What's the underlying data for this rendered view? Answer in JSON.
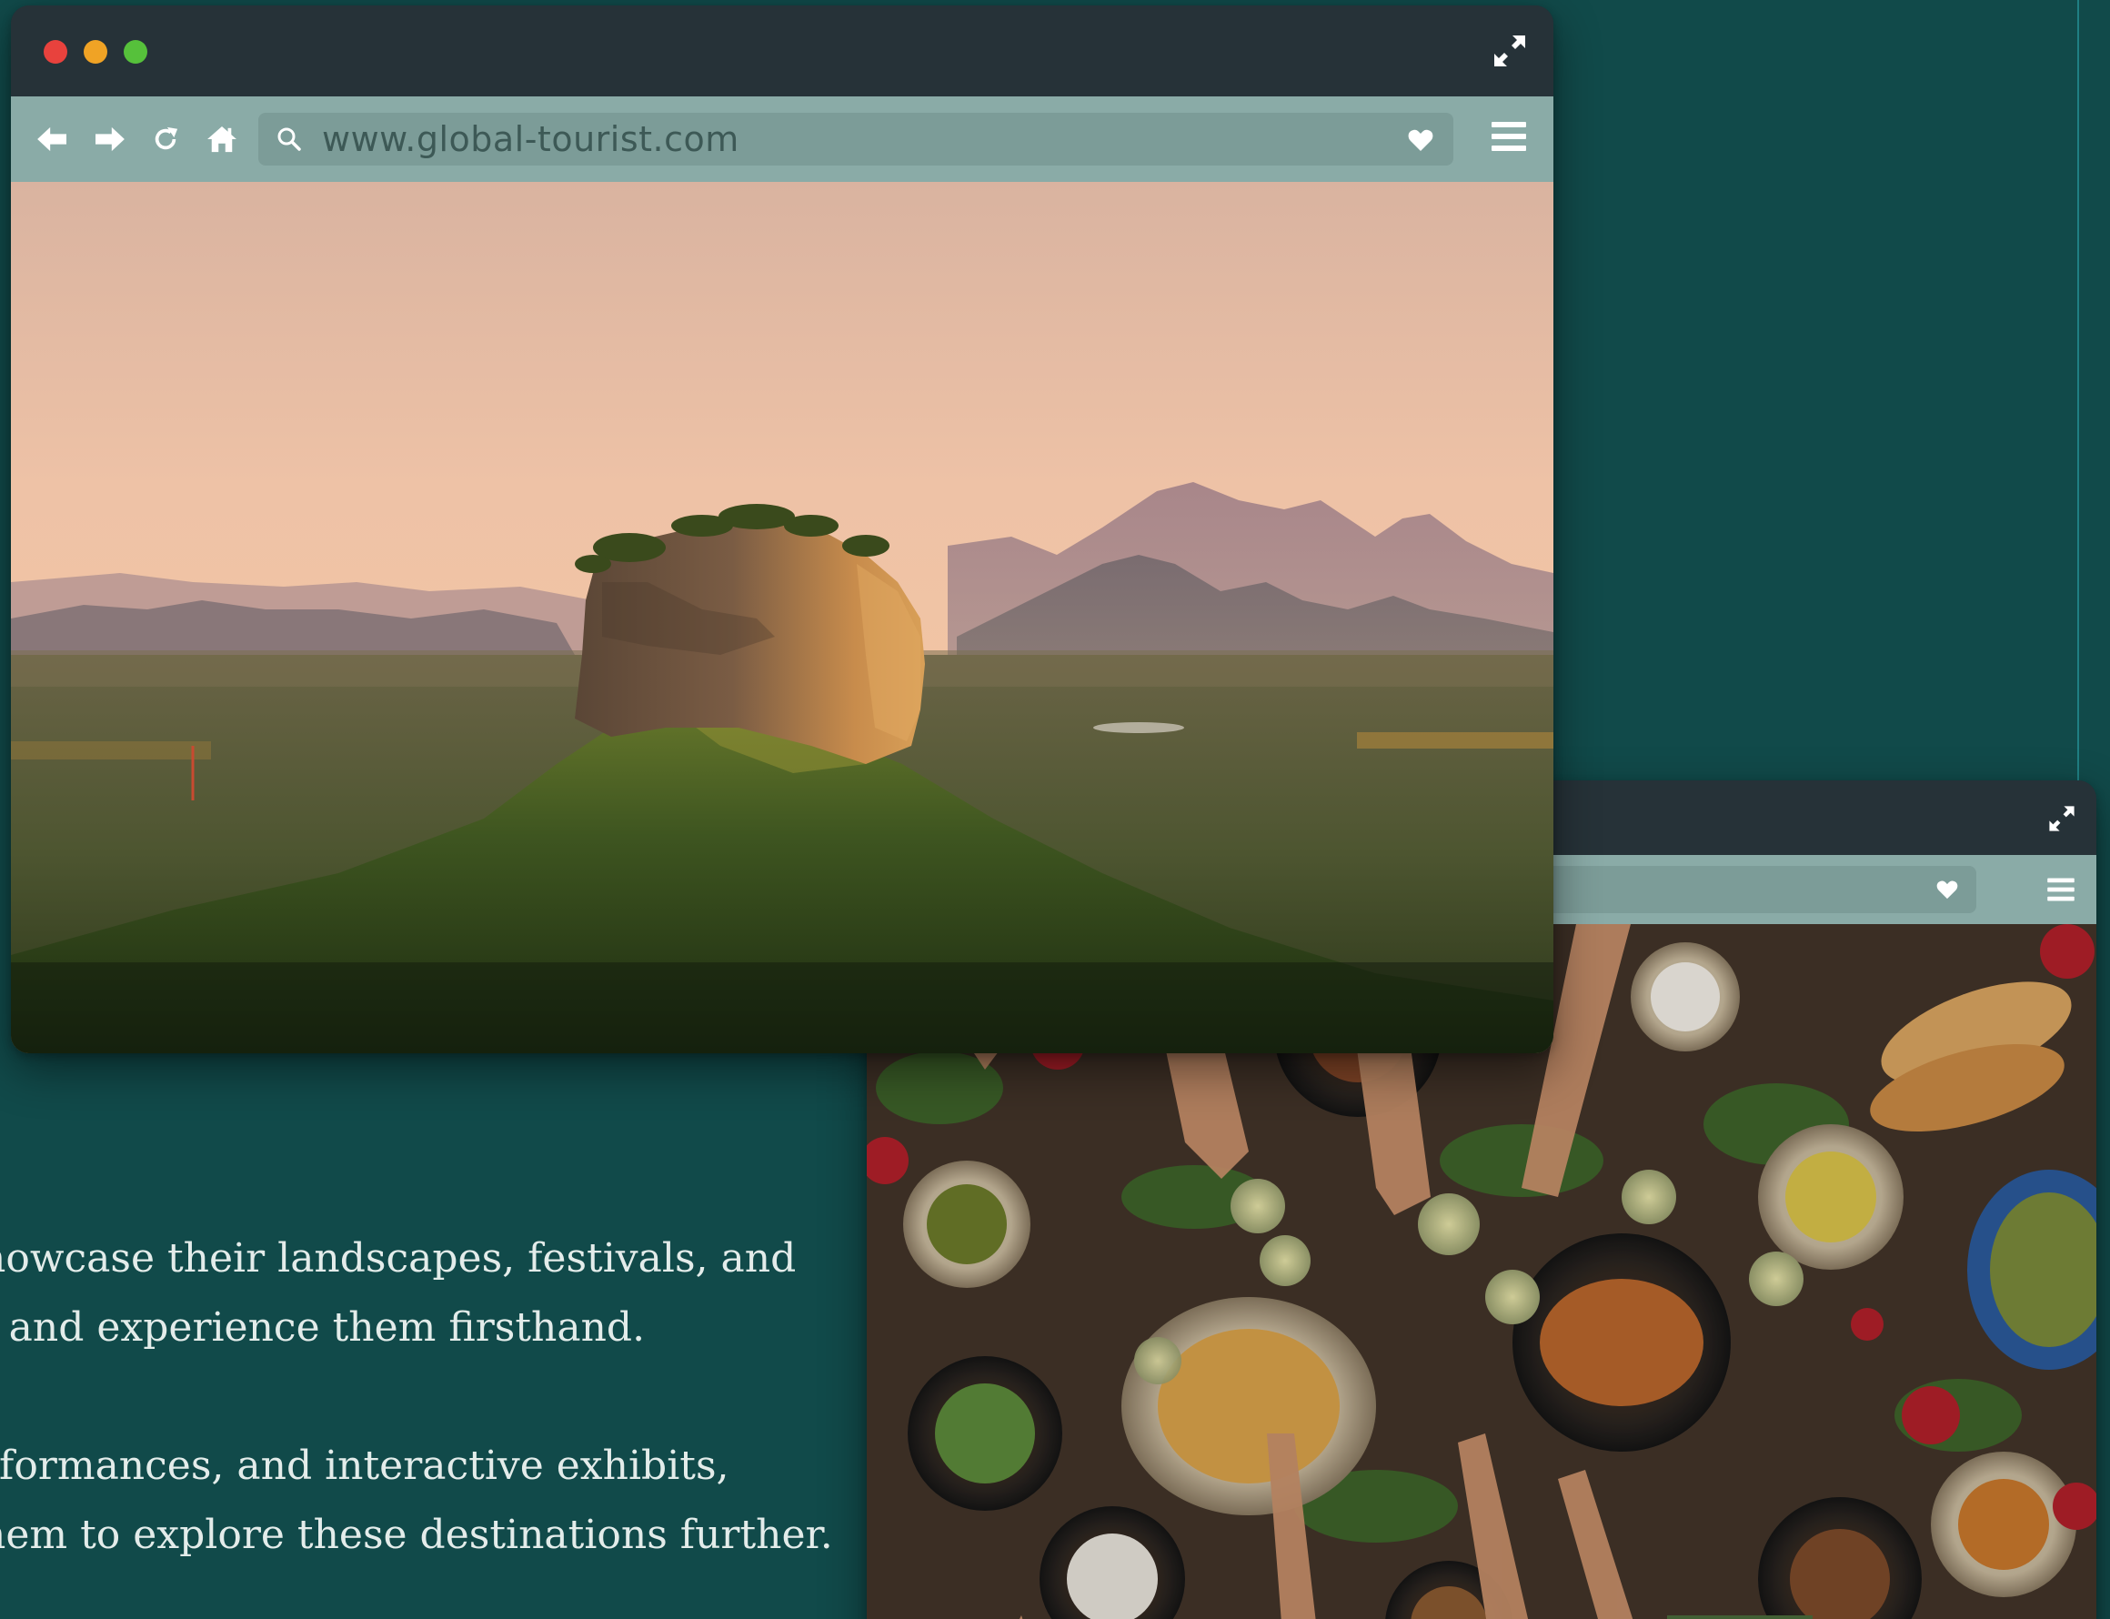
{
  "browser_main": {
    "url": "www.global-tourist.com",
    "image_alt": "Sigiriya rock fortress at sunset above forest and mountains"
  },
  "browser_back": {
    "image_alt": "Overhead view of a table of shared food with hands raising glasses"
  },
  "copy": {
    "paragraph_1": [
      "howcase their landscapes, festivals, and",
      "t and experience them firsthand."
    ],
    "paragraph_2": [
      "rformances, and interactive exhibits,",
      "hem to explore these destinations further."
    ]
  },
  "icons": {
    "back": "arrow-left-icon",
    "forward": "arrow-right-icon",
    "reload": "reload-icon",
    "home": "home-icon",
    "search": "search-icon",
    "favorite": "heart-icon",
    "menu": "hamburger-menu-icon",
    "expand": "expand-icon"
  },
  "colors": {
    "background": "#114a4a",
    "titlebar": "#263238",
    "toolbar": "#8aaba7",
    "traffic_red": "#e8423d",
    "traffic_yellow": "#f0a325",
    "traffic_green": "#56c13b"
  }
}
